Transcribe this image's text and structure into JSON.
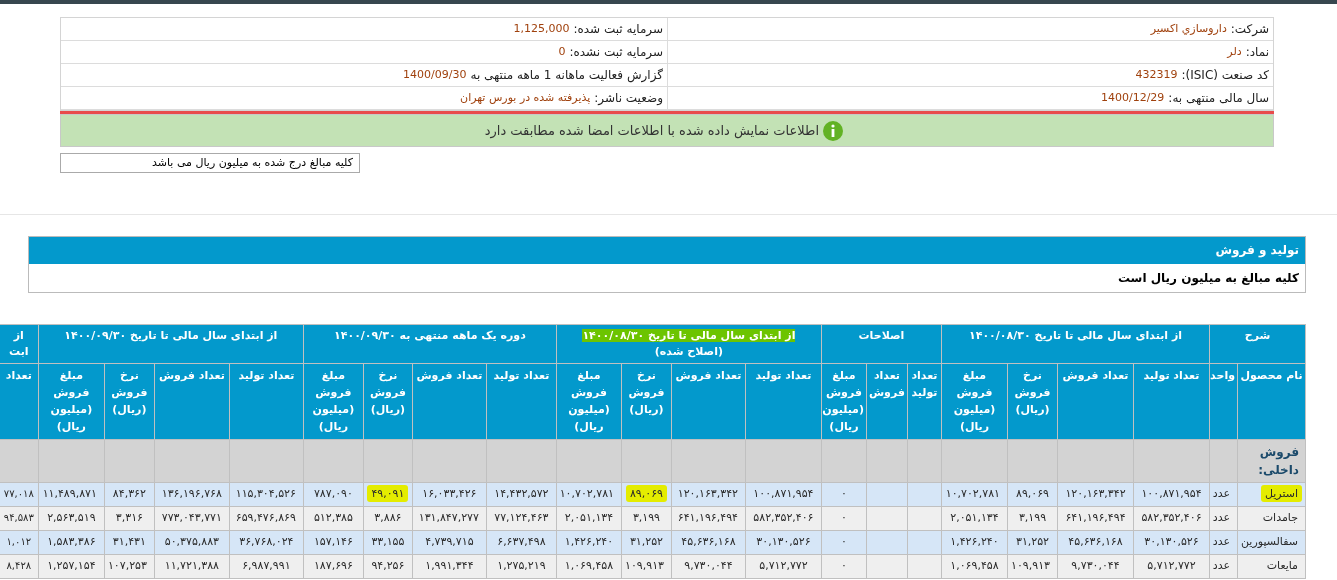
{
  "company_info": [
    {
      "label": "شرکت:",
      "value": "داروسازي اکسير"
    },
    {
      "label": "سرمایه ثبت شده:",
      "value": "1,125,000"
    },
    {
      "label": "نماد:",
      "value": "دلر"
    },
    {
      "label": "سرمایه ثبت نشده:",
      "value": "0"
    },
    {
      "label": "کد صنعت (ISIC):",
      "value": "432319"
    },
    {
      "label": "گزارش فعالیت ماهانه 1 ماهه منتهی به",
      "value": "1400/09/30"
    },
    {
      "label": "سال مالی منتهی به:",
      "value": "1400/12/29"
    },
    {
      "label": "وضعیت ناشر:",
      "value": "پذیرفته شده در بورس تهران"
    }
  ],
  "verification_banner": "اطلاعات نمایش داده شده با اطلاعات امضا شده مطابقت دارد",
  "amounts_note": "کلیه مبالغ درج شده به میلیون ریال می باشد",
  "section": {
    "title": "تولید و فروش",
    "note": "کلیه مبالغ به میلیون ریال است"
  },
  "table": {
    "groups": [
      {
        "title": "شرح",
        "highlighted": false,
        "columns": [
          "نام محصول",
          "واحد"
        ]
      },
      {
        "title": "از ابتدای سال مالی تا تاریخ ۱۴۰۰/۰۸/۳۰",
        "highlighted": false,
        "columns": [
          "تعداد تولید",
          "تعداد فروش",
          "نرخ فروش (ریال)",
          "مبلغ فروش (میلیون ریال)"
        ]
      },
      {
        "title": "اصلاحات",
        "highlighted": false,
        "columns": [
          "تعداد تولید",
          "تعداد فروش",
          "مبلغ فروش (میلیون ریال)"
        ]
      },
      {
        "title": "از ابتدای سال مالی تا تاریخ ۱۴۰۰/۰۸/۳۰",
        "subtitle": "(اصلاح شده)",
        "highlighted": true,
        "columns": [
          "تعداد تولید",
          "تعداد فروش",
          "نرخ فروش (ریال)",
          "مبلغ فروش (میلیون ریال)"
        ]
      },
      {
        "title": "دوره یک ماهه منتهی به ۱۴۰۰/۰۹/۳۰",
        "highlighted": false,
        "columns": [
          "تعداد تولید",
          "تعداد فروش",
          "نرخ فروش (ریال)",
          "مبلغ فروش (میلیون ریال)"
        ]
      },
      {
        "title": "از ابتدای سال مالی تا تاریخ ۱۴۰۰/۰۹/۳۰",
        "highlighted": false,
        "columns": [
          "تعداد تولید",
          "تعداد فروش",
          "نرخ فروش (ریال)",
          "مبلغ فروش (میلیون ریال)"
        ]
      },
      {
        "title": "از ابت",
        "highlighted": false,
        "columns": [
          "تعداد"
        ]
      }
    ],
    "rows": [
      {
        "kind": "category",
        "label": "فروش داخلی:"
      },
      {
        "kind": "product",
        "cells": [
          {
            "text": "استریل",
            "highlighted": true
          },
          {
            "text": "عدد",
            "highlighted": false
          },
          {
            "text": "۱۰۰,۸۷۱,۹۵۴",
            "highlighted": false
          },
          {
            "text": "۱۲۰,۱۶۳,۳۴۲",
            "highlighted": false
          },
          {
            "text": "۸۹,۰۶۹",
            "highlighted": false
          },
          {
            "text": "۱۰,۷۰۲,۷۸۱",
            "highlighted": false
          },
          {
            "highlighted": false
          },
          {
            "highlighted": false
          },
          {
            "text": "۰",
            "highlighted": false
          },
          {
            "text": "۱۰۰,۸۷۱,۹۵۴",
            "highlighted": false
          },
          {
            "text": "۱۲۰,۱۶۳,۳۴۲",
            "highlighted": false
          },
          {
            "text": "۸۹,۰۶۹",
            "highlighted": true
          },
          {
            "text": "۱۰,۷۰۲,۷۸۱",
            "highlighted": false
          },
          {
            "text": "۱۴,۴۳۲,۵۷۲",
            "highlighted": false
          },
          {
            "text": "۱۶,۰۳۳,۴۲۶",
            "highlighted": false
          },
          {
            "text": "۴۹,۰۹۱",
            "highlighted": true
          },
          {
            "text": "۷۸۷,۰۹۰",
            "highlighted": false
          },
          {
            "text": "۱۱۵,۳۰۴,۵۲۶",
            "highlighted": false
          },
          {
            "text": "۱۳۶,۱۹۶,۷۶۸",
            "highlighted": false
          },
          {
            "text": "۸۴,۳۶۲",
            "highlighted": false
          },
          {
            "text": "۱۱,۴۸۹,۸۷۱",
            "highlighted": false
          },
          {
            "text": "۷۷,۰۱۸",
            "highlighted": false
          }
        ]
      },
      {
        "kind": "product",
        "cells": [
          {
            "text": "جامدات",
            "highlighted": false
          },
          {
            "text": "عدد",
            "highlighted": false
          },
          {
            "text": "۵۸۲,۳۵۲,۴۰۶",
            "highlighted": false
          },
          {
            "text": "۶۴۱,۱۹۶,۴۹۴",
            "highlighted": false
          },
          {
            "text": "۳,۱۹۹",
            "highlighted": false
          },
          {
            "text": "۲,۰۵۱,۱۳۴",
            "highlighted": false
          },
          {
            "highlighted": false
          },
          {
            "highlighted": false
          },
          {
            "text": "۰",
            "highlighted": false
          },
          {
            "text": "۵۸۲,۳۵۲,۴۰۶",
            "highlighted": false
          },
          {
            "text": "۶۴۱,۱۹۶,۴۹۴",
            "highlighted": false
          },
          {
            "text": "۳,۱۹۹",
            "highlighted": false
          },
          {
            "text": "۲,۰۵۱,۱۳۴",
            "highlighted": false
          },
          {
            "text": "۷۷,۱۲۴,۴۶۳",
            "highlighted": false
          },
          {
            "text": "۱۳۱,۸۴۷,۲۷۷",
            "highlighted": false
          },
          {
            "text": "۳,۸۸۶",
            "highlighted": false
          },
          {
            "text": "۵۱۲,۳۸۵",
            "highlighted": false
          },
          {
            "text": "۶۵۹,۴۷۶,۸۶۹",
            "highlighted": false
          },
          {
            "text": "۷۷۳,۰۴۳,۷۷۱",
            "highlighted": false
          },
          {
            "text": "۳,۳۱۶",
            "highlighted": false
          },
          {
            "text": "۲,۵۶۳,۵۱۹",
            "highlighted": false
          },
          {
            "text": "۹۴,۵۸۳",
            "highlighted": false
          }
        ]
      },
      {
        "kind": "product",
        "cells": [
          {
            "text": "سفالسپورین",
            "highlighted": false
          },
          {
            "text": "عدد",
            "highlighted": false
          },
          {
            "text": "۳۰,۱۳۰,۵۲۶",
            "highlighted": false
          },
          {
            "text": "۴۵,۶۳۶,۱۶۸",
            "highlighted": false
          },
          {
            "text": "۳۱,۲۵۲",
            "highlighted": false
          },
          {
            "text": "۱,۴۲۶,۲۴۰",
            "highlighted": false
          },
          {
            "highlighted": false
          },
          {
            "highlighted": false
          },
          {
            "text": "۰",
            "highlighted": false
          },
          {
            "text": "۳۰,۱۳۰,۵۲۶",
            "highlighted": false
          },
          {
            "text": "۴۵,۶۳۶,۱۶۸",
            "highlighted": false
          },
          {
            "text": "۳۱,۲۵۲",
            "highlighted": false
          },
          {
            "text": "۱,۴۲۶,۲۴۰",
            "highlighted": false
          },
          {
            "text": "۶,۶۳۷,۴۹۸",
            "highlighted": false
          },
          {
            "text": "۴,۷۳۹,۷۱۵",
            "highlighted": false
          },
          {
            "text": "۳۳,۱۵۵",
            "highlighted": false
          },
          {
            "text": "۱۵۷,۱۴۶",
            "highlighted": false
          },
          {
            "text": "۳۶,۷۶۸,۰۲۴",
            "highlighted": false
          },
          {
            "text": "۵۰,۳۷۵,۸۸۳",
            "highlighted": false
          },
          {
            "text": "۳۱,۴۳۱",
            "highlighted": false
          },
          {
            "text": "۱,۵۸۳,۳۸۶",
            "highlighted": false
          },
          {
            "text": "۱,۰۱۲",
            "highlighted": false
          }
        ]
      },
      {
        "kind": "product",
        "cells": [
          {
            "text": "مایعات",
            "highlighted": false
          },
          {
            "text": "عدد",
            "highlighted": false
          },
          {
            "text": "۵,۷۱۲,۷۷۲",
            "highlighted": false
          },
          {
            "text": "۹,۷۳۰,۰۴۴",
            "highlighted": false
          },
          {
            "text": "۱۰۹,۹۱۳",
            "highlighted": false
          },
          {
            "text": "۱,۰۶۹,۴۵۸",
            "highlighted": false
          },
          {
            "highlighted": false
          },
          {
            "highlighted": false
          },
          {
            "text": "۰",
            "highlighted": false
          },
          {
            "text": "۵,۷۱۲,۷۷۲",
            "highlighted": false
          },
          {
            "text": "۹,۷۳۰,۰۴۴",
            "highlighted": false
          },
          {
            "text": "۱۰۹,۹۱۳",
            "highlighted": false
          },
          {
            "text": "۱,۰۶۹,۴۵۸",
            "highlighted": false
          },
          {
            "text": "۱,۲۷۵,۲۱۹",
            "highlighted": false
          },
          {
            "text": "۱,۹۹۱,۳۴۴",
            "highlighted": false
          },
          {
            "text": "۹۴,۲۵۶",
            "highlighted": false
          },
          {
            "text": "۱۸۷,۶۹۶",
            "highlighted": false
          },
          {
            "text": "۶,۹۸۷,۹۹۱",
            "highlighted": false
          },
          {
            "text": "۱۱,۷۲۱,۳۸۸",
            "highlighted": false
          },
          {
            "text": "۱۰۷,۲۵۳",
            "highlighted": false
          },
          {
            "text": "۱,۲۵۷,۱۵۴",
            "highlighted": false
          },
          {
            "text": "۸,۴۲۸",
            "highlighted": false
          }
        ]
      }
    ]
  }
}
